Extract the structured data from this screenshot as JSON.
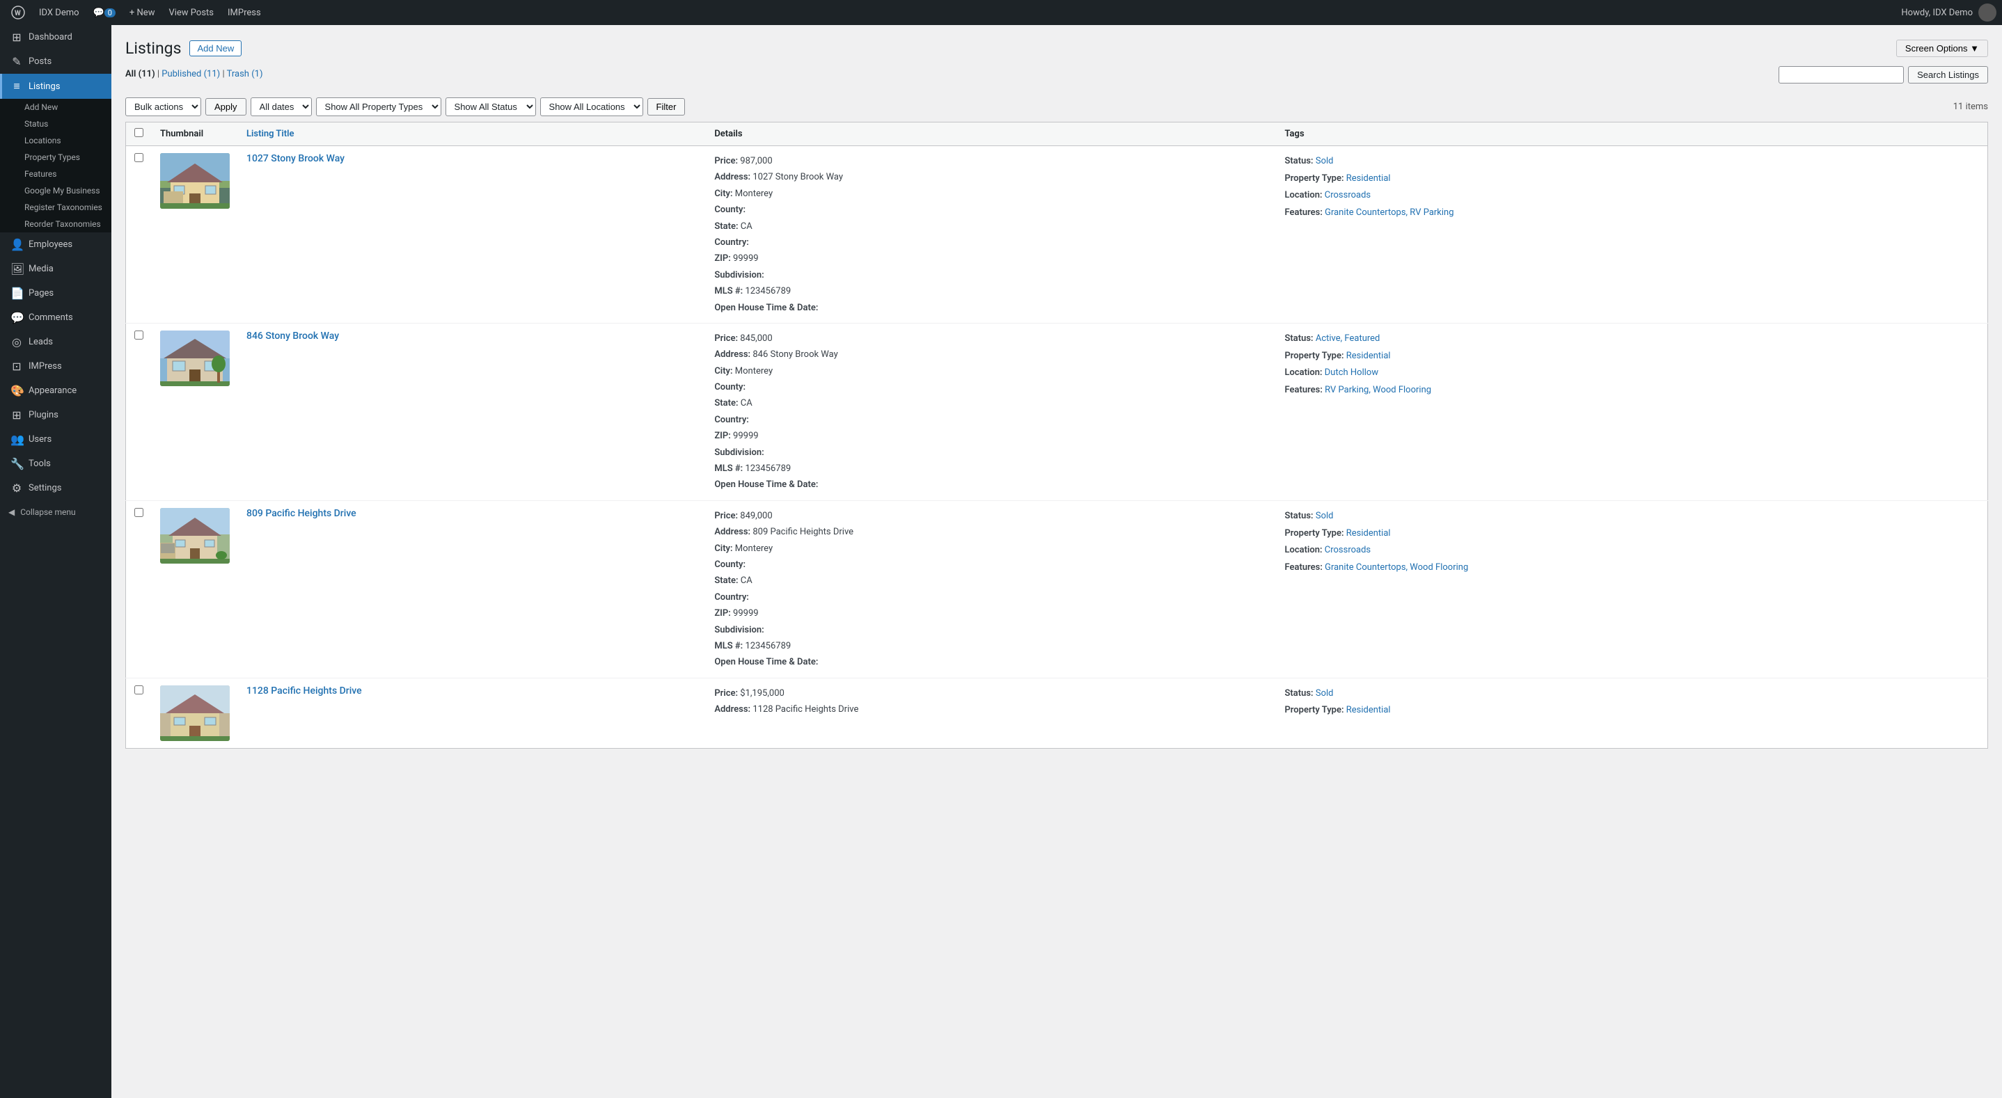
{
  "adminbar": {
    "site_name": "IDX Demo",
    "comment_count": "0",
    "new_label": "+ New",
    "view_posts": "View Posts",
    "impress": "IMPress",
    "howdy": "Howdy, IDX Demo"
  },
  "screen_options": {
    "label": "Screen Options ▼"
  },
  "page": {
    "title": "Listings",
    "add_new": "Add New"
  },
  "subsubsub": {
    "all": "All",
    "all_count": "11",
    "published": "Published",
    "published_count": "11",
    "trash": "Trash",
    "trash_count": "1"
  },
  "search": {
    "placeholder": "",
    "button": "Search Listings"
  },
  "tablenav": {
    "bulk_actions": "Bulk actions",
    "apply": "Apply",
    "dates": "All dates",
    "property_types": "Show All Property Types",
    "status": "Show All Status",
    "locations": "Show All Locations",
    "filter": "Filter",
    "items_count": "11 items"
  },
  "table": {
    "columns": [
      "Thumbnail",
      "Listing Title",
      "Details",
      "Tags"
    ],
    "rows": [
      {
        "id": 1,
        "title": "1027 Stony Brook Way",
        "price": "987,000",
        "address": "1027 Stony Brook Way",
        "city": "Monterey",
        "county": "",
        "state": "CA",
        "country": "",
        "zip": "99999",
        "subdivision": "",
        "mls": "123456789",
        "open_house": "",
        "status_label": "Status:",
        "status_value": "Sold",
        "property_type_label": "Property Type:",
        "property_type_value": "Residential",
        "location_label": "Location:",
        "location_value": "Crossroads",
        "features_label": "Features:",
        "features": "Granite Countertops, RV Parking",
        "bg_color": "#a8b89a"
      },
      {
        "id": 2,
        "title": "846 Stony Brook Way",
        "price": "845,000",
        "address": "846 Stony Brook Way",
        "city": "Monterey",
        "county": "",
        "state": "CA",
        "country": "",
        "zip": "99999",
        "subdivision": "",
        "mls": "123456789",
        "open_house": "",
        "status_label": "Status:",
        "status_value": "Active, Featured",
        "property_type_label": "Property Type:",
        "property_type_value": "Residential",
        "location_label": "Location:",
        "location_value": "Dutch Hollow",
        "features_label": "Features:",
        "features": "RV Parking, Wood Flooring",
        "bg_color": "#7b9eb5"
      },
      {
        "id": 3,
        "title": "809 Pacific Heights Drive",
        "price": "849,000",
        "address": "809 Pacific Heights Drive",
        "city": "Monterey",
        "county": "",
        "state": "CA",
        "country": "",
        "zip": "99999",
        "subdivision": "",
        "mls": "123456789",
        "open_house": "",
        "status_label": "Status:",
        "status_value": "Sold",
        "property_type_label": "Property Type:",
        "property_type_value": "Residential",
        "location_label": "Location:",
        "location_value": "Crossroads",
        "features_label": "Features:",
        "features": "Granite Countertops, Wood Flooring",
        "bg_color": "#b5c4a0"
      },
      {
        "id": 4,
        "title": "1128 Pacific Heights Drive",
        "price": "$1,195,000",
        "address": "1128 Pacific Heights Drive",
        "city": "",
        "county": "",
        "state": "",
        "country": "",
        "zip": "",
        "subdivision": "",
        "mls": "",
        "open_house": "",
        "status_label": "Status:",
        "status_value": "Sold",
        "property_type_label": "Property Type:",
        "property_type_value": "Residential",
        "location_label": "",
        "location_value": "",
        "features_label": "",
        "features": "",
        "bg_color": "#c4b89a"
      }
    ]
  },
  "sidebar": {
    "items": [
      {
        "label": "Dashboard",
        "icon": "⊞",
        "active": false
      },
      {
        "label": "Posts",
        "icon": "✎",
        "active": false
      },
      {
        "label": "Listings",
        "icon": "⊟",
        "active": true
      },
      {
        "label": "Add New",
        "icon": "",
        "sub": true
      },
      {
        "label": "Status",
        "icon": "",
        "sub": true
      },
      {
        "label": "Locations",
        "icon": "",
        "sub": true
      },
      {
        "label": "Property Types",
        "icon": "",
        "sub": true
      },
      {
        "label": "Features",
        "icon": "",
        "sub": true
      },
      {
        "label": "Google My Business",
        "icon": "",
        "sub": true
      },
      {
        "label": "Register Taxonomies",
        "icon": "",
        "sub": true
      },
      {
        "label": "Reorder Taxonomies",
        "icon": "",
        "sub": true
      },
      {
        "label": "Employees",
        "icon": "👤",
        "active": false
      },
      {
        "label": "Media",
        "icon": "🖼",
        "active": false
      },
      {
        "label": "Pages",
        "icon": "📄",
        "active": false
      },
      {
        "label": "Comments",
        "icon": "💬",
        "active": false
      },
      {
        "label": "Leads",
        "icon": "◎",
        "active": false
      },
      {
        "label": "IMPress",
        "icon": "⊡",
        "active": false
      },
      {
        "label": "Appearance",
        "icon": "🎨",
        "active": false
      },
      {
        "label": "Plugins",
        "icon": "⊞",
        "active": false
      },
      {
        "label": "Users",
        "icon": "👥",
        "active": false
      },
      {
        "label": "Tools",
        "icon": "🔧",
        "active": false
      },
      {
        "label": "Settings",
        "icon": "⚙",
        "active": false
      },
      {
        "label": "Collapse menu",
        "icon": "◀",
        "active": false
      }
    ]
  }
}
